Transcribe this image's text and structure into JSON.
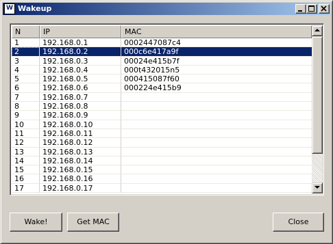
{
  "window": {
    "title": "Wakeup",
    "icon": "app-icon",
    "icon_glyph": "W",
    "controls": [
      "minimize-icon",
      "maximize-icon",
      "close-icon"
    ]
  },
  "list": {
    "columns": [
      "N",
      "IP",
      "MAC"
    ],
    "selected_index": 1,
    "rows": [
      {
        "n": "1",
        "ip": "192.168.0.1",
        "mac": "0002447087c4"
      },
      {
        "n": "2",
        "ip": "192.168.0.2",
        "mac": "000c6e417a9f"
      },
      {
        "n": "3",
        "ip": "192.168.0.3",
        "mac": "00024e415b7f"
      },
      {
        "n": "4",
        "ip": "192.168.0.4",
        "mac": "000t432015n5"
      },
      {
        "n": "5",
        "ip": "192.168.0.5",
        "mac": "000415087f60"
      },
      {
        "n": "6",
        "ip": "192.168.0.6",
        "mac": "000224e415b9"
      },
      {
        "n": "7",
        "ip": "192.168.0.7",
        "mac": ""
      },
      {
        "n": "8",
        "ip": "192.168.0.8",
        "mac": ""
      },
      {
        "n": "9",
        "ip": "192.168.0.9",
        "mac": ""
      },
      {
        "n": "10",
        "ip": "192.168.0.10",
        "mac": ""
      },
      {
        "n": "11",
        "ip": "192.168.0.11",
        "mac": ""
      },
      {
        "n": "12",
        "ip": "192.168.0.12",
        "mac": ""
      },
      {
        "n": "13",
        "ip": "192.168.0.13",
        "mac": ""
      },
      {
        "n": "14",
        "ip": "192.168.0.14",
        "mac": ""
      },
      {
        "n": "15",
        "ip": "192.168.0.15",
        "mac": ""
      },
      {
        "n": "16",
        "ip": "192.168.0.16",
        "mac": ""
      },
      {
        "n": "17",
        "ip": "192.168.0.17",
        "mac": ""
      }
    ]
  },
  "buttons": {
    "wake": "Wake!",
    "get_mac": "Get MAC",
    "close": "Close"
  },
  "colors": {
    "selection": "#0a246a",
    "face": "#d4d0c8"
  }
}
